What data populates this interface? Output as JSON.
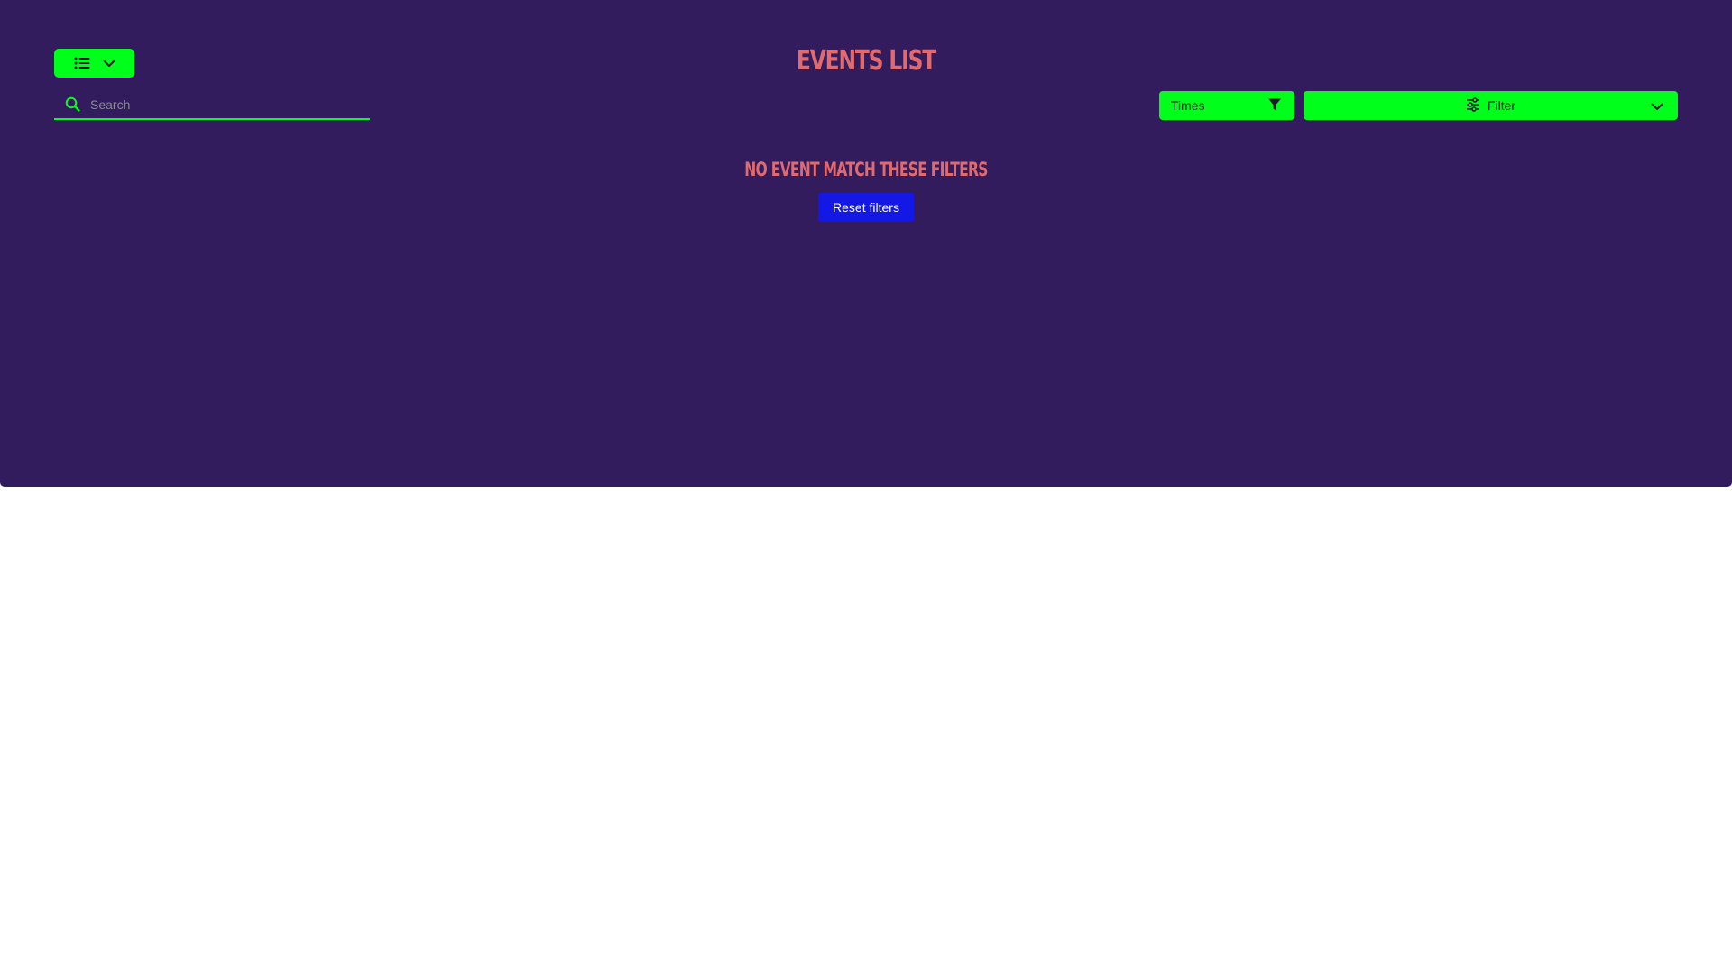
{
  "colors": {
    "panel_background": "#321c5e",
    "accent_green": "#00ff1a",
    "title_color": "#e06a6e",
    "reset_button_background": "#1318e6"
  },
  "header": {
    "title": "Events list",
    "view_toggle": {
      "icon": "list-icon",
      "chevron": "chevron-down-icon"
    }
  },
  "search": {
    "icon": "search-icon",
    "placeholder": "Search",
    "value": ""
  },
  "filters": {
    "times": {
      "label": "Times",
      "icon": "funnel-icon"
    },
    "filter": {
      "label": "Filter",
      "icon": "sliders-icon",
      "chevron": "chevron-down-icon"
    }
  },
  "empty_state": {
    "message": "No event match these filters",
    "reset_label": "Reset filters"
  }
}
